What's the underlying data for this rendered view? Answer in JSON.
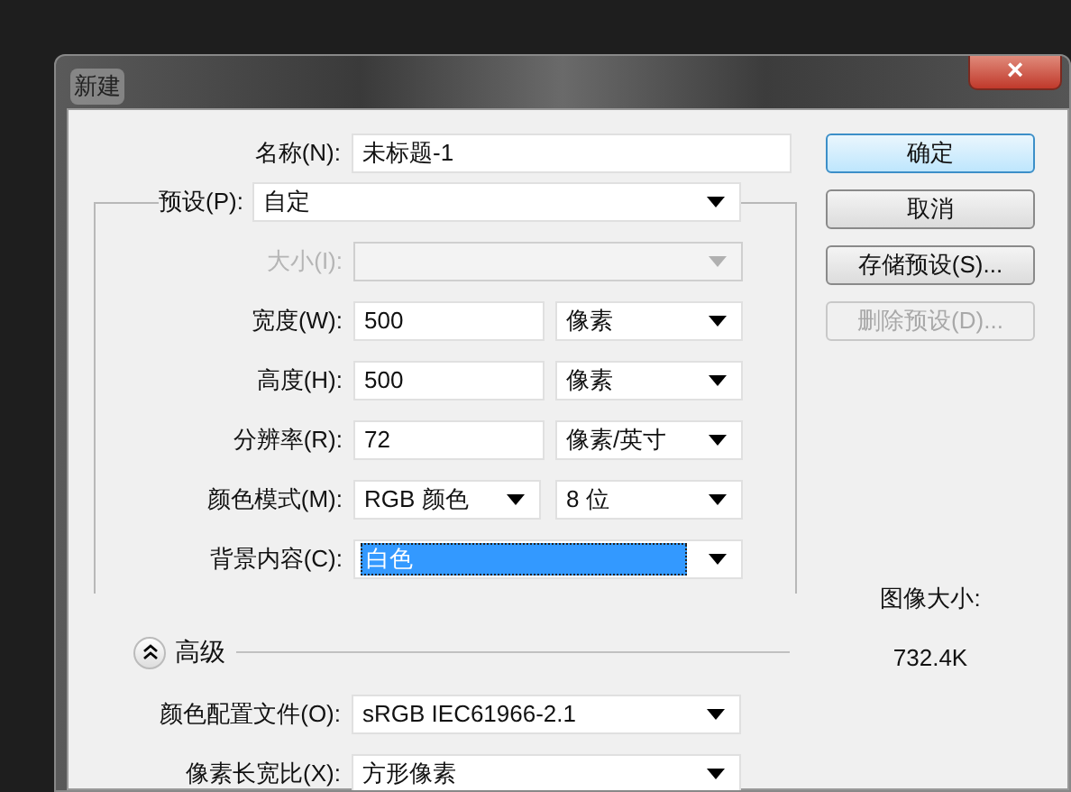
{
  "window": {
    "title": "新建",
    "close": "×"
  },
  "name_field": {
    "label": "名称(N):",
    "value": "未标题-1"
  },
  "preset": {
    "label": "预设(P):",
    "value": "自定"
  },
  "fields": [
    {
      "kind": "select",
      "label": "大小(I):",
      "disabled": true
    },
    {
      "kind": "number_unit",
      "label": "宽度(W):",
      "value": "500",
      "unit": "像素"
    },
    {
      "kind": "number_unit",
      "label": "高度(H):",
      "value": "500",
      "unit": "像素"
    },
    {
      "kind": "number_unit",
      "label": "分辨率(R):",
      "value": "72",
      "unit": "像素/英寸"
    },
    {
      "kind": "select_pair",
      "label": "颜色模式(M):",
      "value": "RGB 颜色",
      "unit": "8 位"
    },
    {
      "kind": "select",
      "label": "背景内容(C):",
      "value": "白色",
      "disabled": false,
      "highlighted": true
    }
  ],
  "advanced": {
    "label": "高级",
    "expanded": true
  },
  "advanced_fields": [
    {
      "label": "颜色配置文件(O):",
      "value": "sRGB IEC61966-2.1"
    },
    {
      "label": "像素长宽比(X):",
      "value": "方形像素"
    }
  ],
  "buttons": [
    {
      "label": "确定",
      "default": true,
      "disabled": false
    },
    {
      "label": "取消",
      "default": false,
      "disabled": false
    },
    {
      "label": "存储预设(S)...",
      "default": false,
      "disabled": false
    },
    {
      "label": "删除预设(D)...",
      "default": false,
      "disabled": true
    }
  ],
  "image_size": {
    "label": "图像大小:",
    "value": "732.4K"
  }
}
